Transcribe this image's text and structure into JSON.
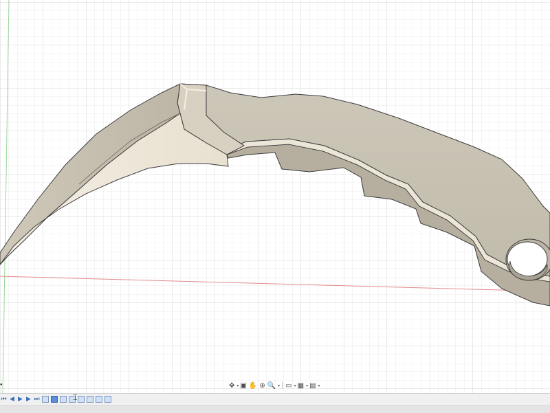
{
  "app": {
    "view": "3D model viewport",
    "model": "karambit-style curved knife body"
  },
  "colors": {
    "canvas_background": "#ffffff",
    "grid_minor": "#e6e6e6",
    "grid_major": "#d4d4d4",
    "x_axis": "#e38a8a",
    "y_axis": "#9ad69a",
    "model_face": "#c8c2b3",
    "model_side": "#b8b1a2",
    "model_edge": "#3b3b3b",
    "blade_highlight": "#efe8da",
    "timeline_background": "#f0f0f0",
    "timeline_accent": "#3d6fb6"
  },
  "navigation_bar": {
    "items": [
      {
        "name": "orbit-icon",
        "glyph": "✥"
      },
      {
        "name": "look-at-icon",
        "glyph": "▣"
      },
      {
        "name": "pan-icon",
        "glyph": "✋"
      },
      {
        "name": "zoom-icon",
        "glyph": "⊕"
      },
      {
        "name": "fit-icon",
        "glyph": "🔍"
      },
      {
        "name": "display-settings-icon",
        "glyph": "▭"
      },
      {
        "name": "grid-settings-icon",
        "glyph": "▦"
      },
      {
        "name": "viewports-icon",
        "glyph": "▤"
      }
    ]
  },
  "timeline": {
    "controls": [
      {
        "name": "go-to-start-icon",
        "glyph": "⏮"
      },
      {
        "name": "step-back-icon",
        "glyph": "◀"
      },
      {
        "name": "play-icon",
        "glyph": "▶"
      },
      {
        "name": "step-forward-icon",
        "glyph": "▶"
      },
      {
        "name": "go-to-end-icon",
        "glyph": "⏭"
      }
    ],
    "feature_count": 8,
    "current_marker_glyph": "⌶"
  }
}
